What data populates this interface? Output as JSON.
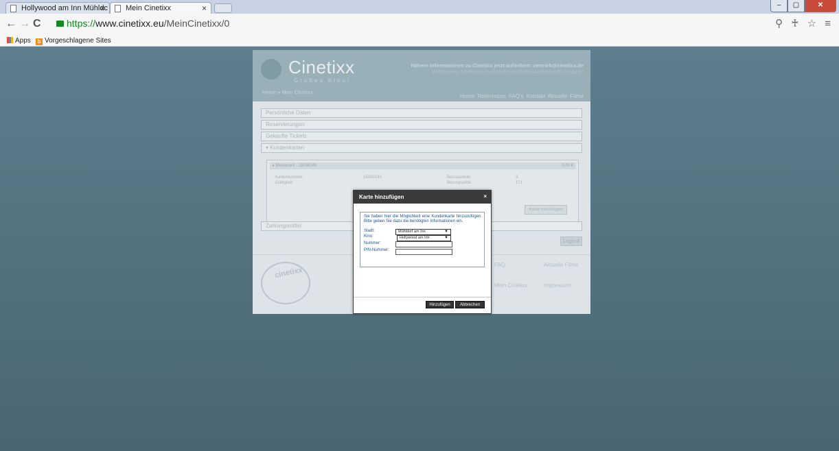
{
  "browser": {
    "tabs": [
      {
        "label": "Hollywood am Inn Mühldc",
        "close": "×"
      },
      {
        "label": "Mein Cinetixx",
        "close": "×"
      }
    ],
    "window_controls": {
      "minimize": "–",
      "maximize": "▢",
      "close": "✕"
    },
    "nav": {
      "back": "←",
      "forward": "→",
      "reload": "C"
    },
    "address": {
      "scheme": "https://",
      "host": "www.cinetixx.eu",
      "path": "/MeinCinetixx/0"
    },
    "right_icons": "⚲ ♰ ☆ ≡",
    "bookmarks": [
      {
        "label": "Apps"
      },
      {
        "label": "Vorgeschlagene Sites"
      }
    ]
  },
  "site": {
    "logo": {
      "name": "Cinetixx",
      "tagline": "Großes Kino!"
    },
    "header_info": "Nähere Informationen zu Cinetixx jetzt anfordern: vertrieb@cinetixx.de",
    "header_links": "Willkommen, Kinokasse.muehldorf.user@hollywoodaminn.de | Logout |",
    "breadcrumb": "Home » Mein Cinetixx",
    "topnav": [
      "Home",
      "Referenzen",
      "FAQ's",
      "Kontakt",
      "Aktuelle Filme"
    ],
    "accordion": [
      {
        "label": "Persönliche Daten"
      },
      {
        "label": "Reservierungen"
      },
      {
        "label": "Gekaufte Tickets"
      },
      {
        "label": "▾ Kundenkarten"
      }
    ],
    "card": {
      "header": "▸ Moviecard - 15006143",
      "amount": "0,00 €",
      "fields": {
        "number_label": "Kartennummer",
        "number_value": "15006143",
        "validity_label": "Gültigkeit",
        "bonus_label": "Bonusanteile",
        "bonus_value": "3",
        "points_label": "Bonuspunkte",
        "points_value": "171"
      }
    },
    "add_card_button": "Karte hinzufügen",
    "payment_item": "Zahlungsmittel",
    "logout_button": "Logout",
    "footer_links": [
      "FAQ",
      "Aktuelle Filme",
      "Mein Cinetixx",
      "Impressum"
    ],
    "footer_logo": "cinetixx"
  },
  "dialog": {
    "title": "Karte hinzufügen",
    "close": "×",
    "text": "Sie haben hier die Möglichkeit eine Kundenkarte hinzuzufügen. Bitte geben Sie dazu die benötigten Informationen ein.",
    "fields": {
      "city_label": "Stadt:",
      "city_value": "Mühldorf am Inn",
      "cinema_label": "Kino:",
      "cinema_value": "Hollywood am Inn",
      "number_label": "Nummer:",
      "pin_label": "PIN-Nummer:"
    },
    "buttons": {
      "add": "Hinzufügen",
      "cancel": "Abbrechen"
    }
  }
}
